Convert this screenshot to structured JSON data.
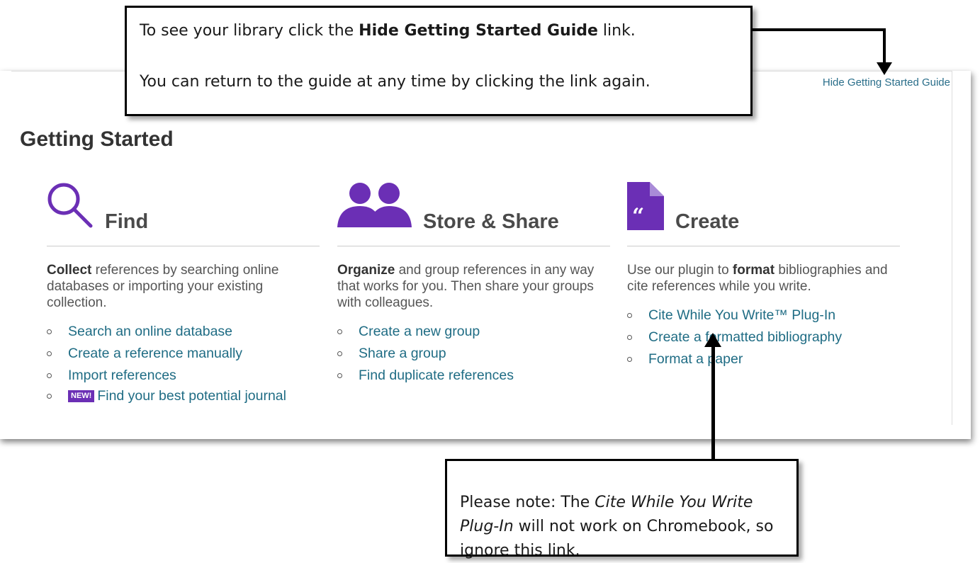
{
  "top_callout": {
    "line1_pre": "To see your library click the ",
    "line1_bold": "Hide Getting Started Guide",
    "line1_post": " link.",
    "line2": "You can return to the guide at any time by clicking the link again."
  },
  "bottom_callout": {
    "pre": "Please note: The ",
    "italic": "Cite While You Write Plug-In",
    "post": " will not work on Chromebook, so ignore this link."
  },
  "header": {
    "hide_link": "Hide Getting Started Guide"
  },
  "page_title": "Getting Started",
  "columns": [
    {
      "icon": "search-icon",
      "title": "Find",
      "desc_bold": "Collect",
      "desc_rest": " references by searching online databases or importing your existing collection.",
      "links": [
        "Search an online database",
        "Create a reference manually",
        "Import references"
      ],
      "new_badge": "NEW!",
      "new_link": "Find your best potential journal"
    },
    {
      "icon": "group-icon",
      "title": "Store & Share",
      "desc_bold": "Organize",
      "desc_rest": " and group references in any way that works for you. Then share your groups with colleagues.",
      "links": [
        "Create a new group",
        "Share a group",
        "Find duplicate references"
      ]
    },
    {
      "icon": "document-quote-icon",
      "title": "Create",
      "desc_pre": "Use our plugin to ",
      "desc_bold": "format",
      "desc_rest": " bibliographies and cite references while you write.",
      "links": [
        "Cite While You Write™ Plug-In",
        "Create a formatted bibliography",
        "Format a paper"
      ]
    }
  ],
  "colors": {
    "accent_purple": "#6b2fb5",
    "link_teal": "#1f6c84"
  }
}
